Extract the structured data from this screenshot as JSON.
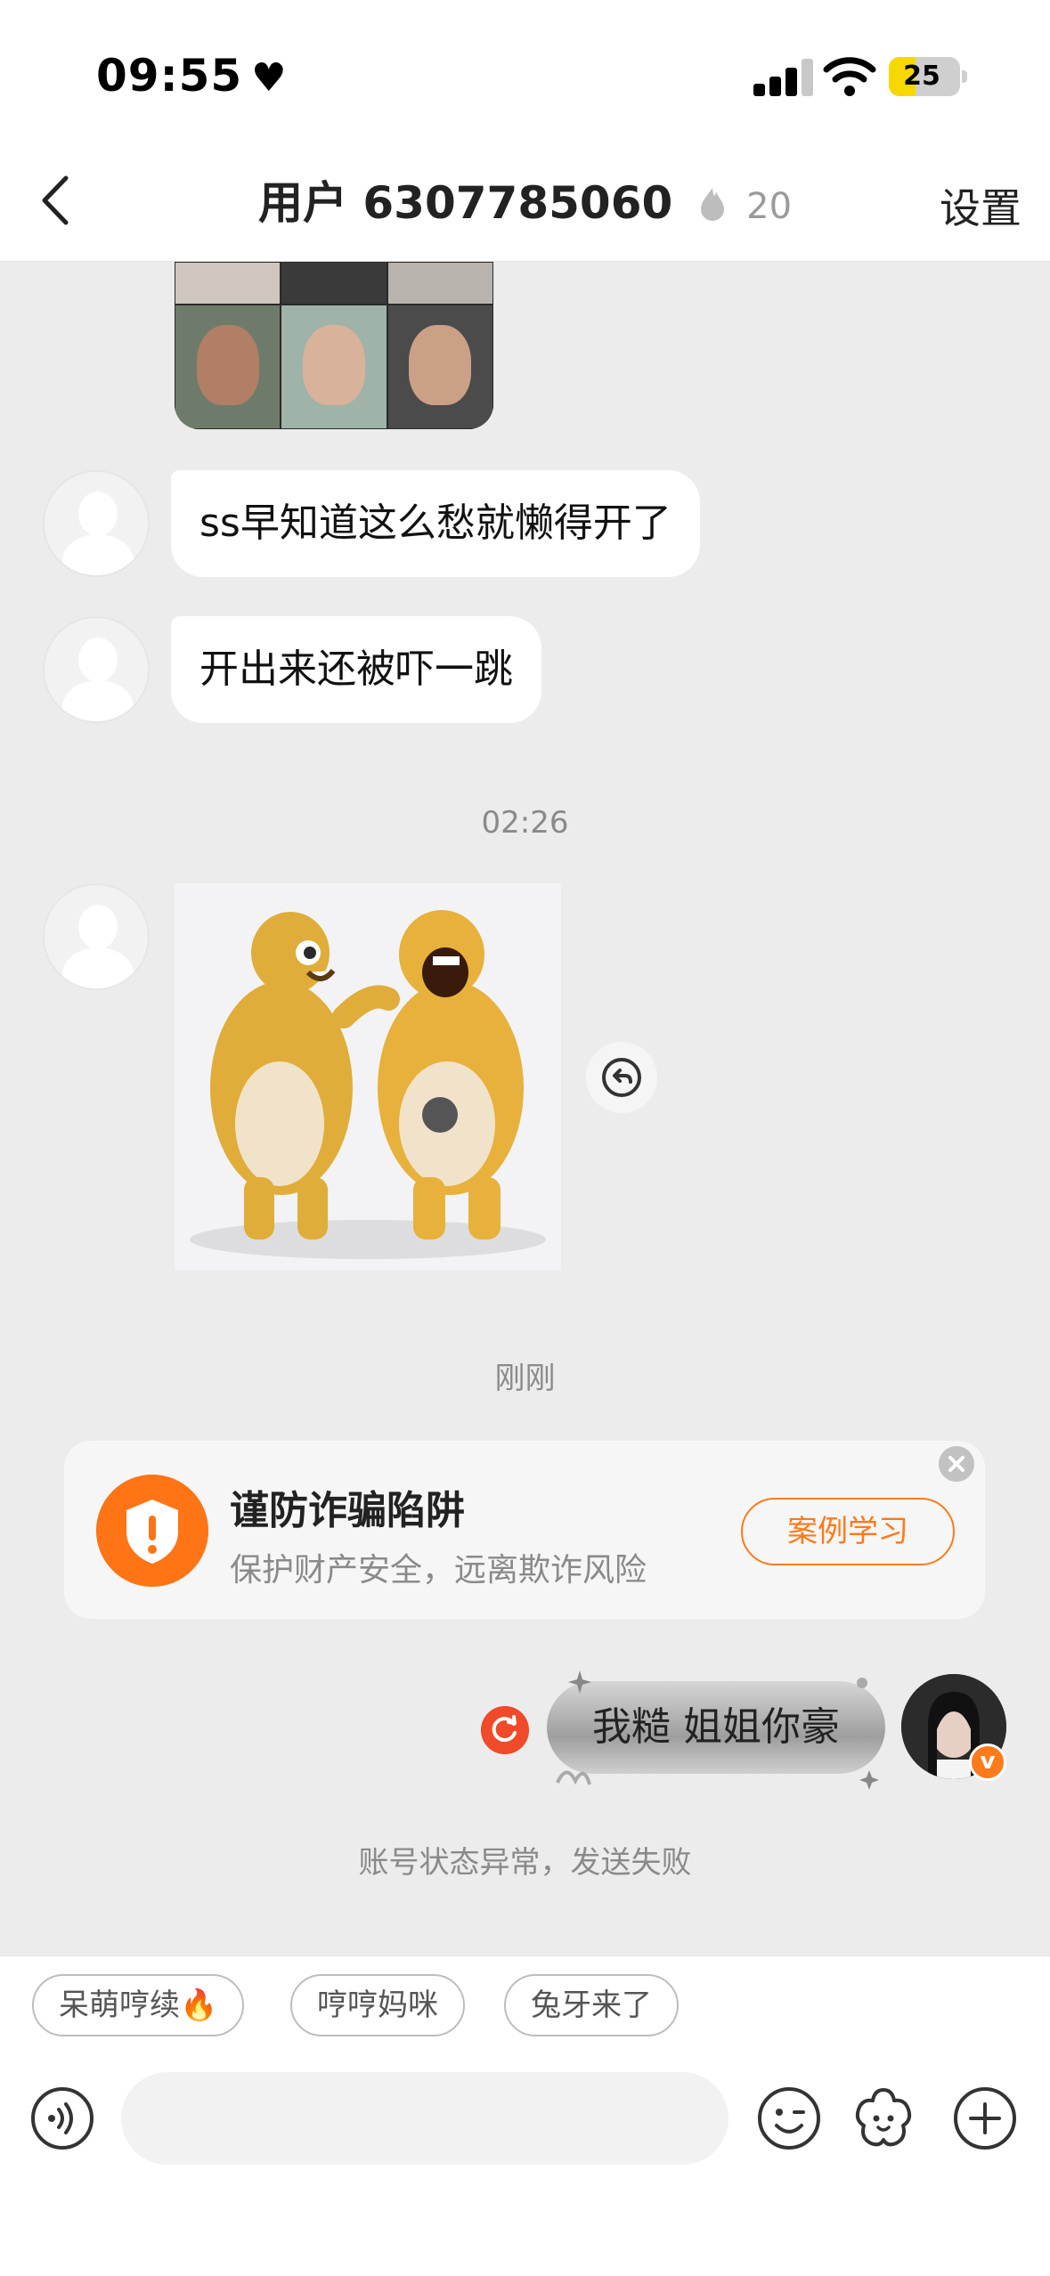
{
  "status_bar": {
    "time": "09:55",
    "battery": "25"
  },
  "header": {
    "title": "用户 6307785060",
    "spark_count": "20",
    "settings_label": "设置"
  },
  "messages": {
    "msg1": "ss早知道这么愁就懒得开了",
    "msg2": "开出来还被吓一跳",
    "time_divider_1": "02:26",
    "time_divider_2": "刚刚",
    "my_message": "我糙 姐姐你豪",
    "send_failed_note": "账号状态异常，发送失败"
  },
  "fraud_notice": {
    "title": "谨防诈骗陷阱",
    "subtitle": "保护财产安全，远离欺诈风险",
    "button_label": "案例学习"
  },
  "quick_replies": [
    "呆萌哼续🔥",
    "哼哼妈咪",
    "兔牙来了"
  ],
  "colors": {
    "accent": "#ff7a1a",
    "background": "#ececec",
    "retry": "#f04a2a"
  },
  "icons": [
    "back-icon",
    "spark-icon",
    "recall-icon",
    "shield-icon",
    "close-icon",
    "retry-icon",
    "voice-icon",
    "emoji-icon",
    "sticker-icon",
    "plus-icon"
  ]
}
